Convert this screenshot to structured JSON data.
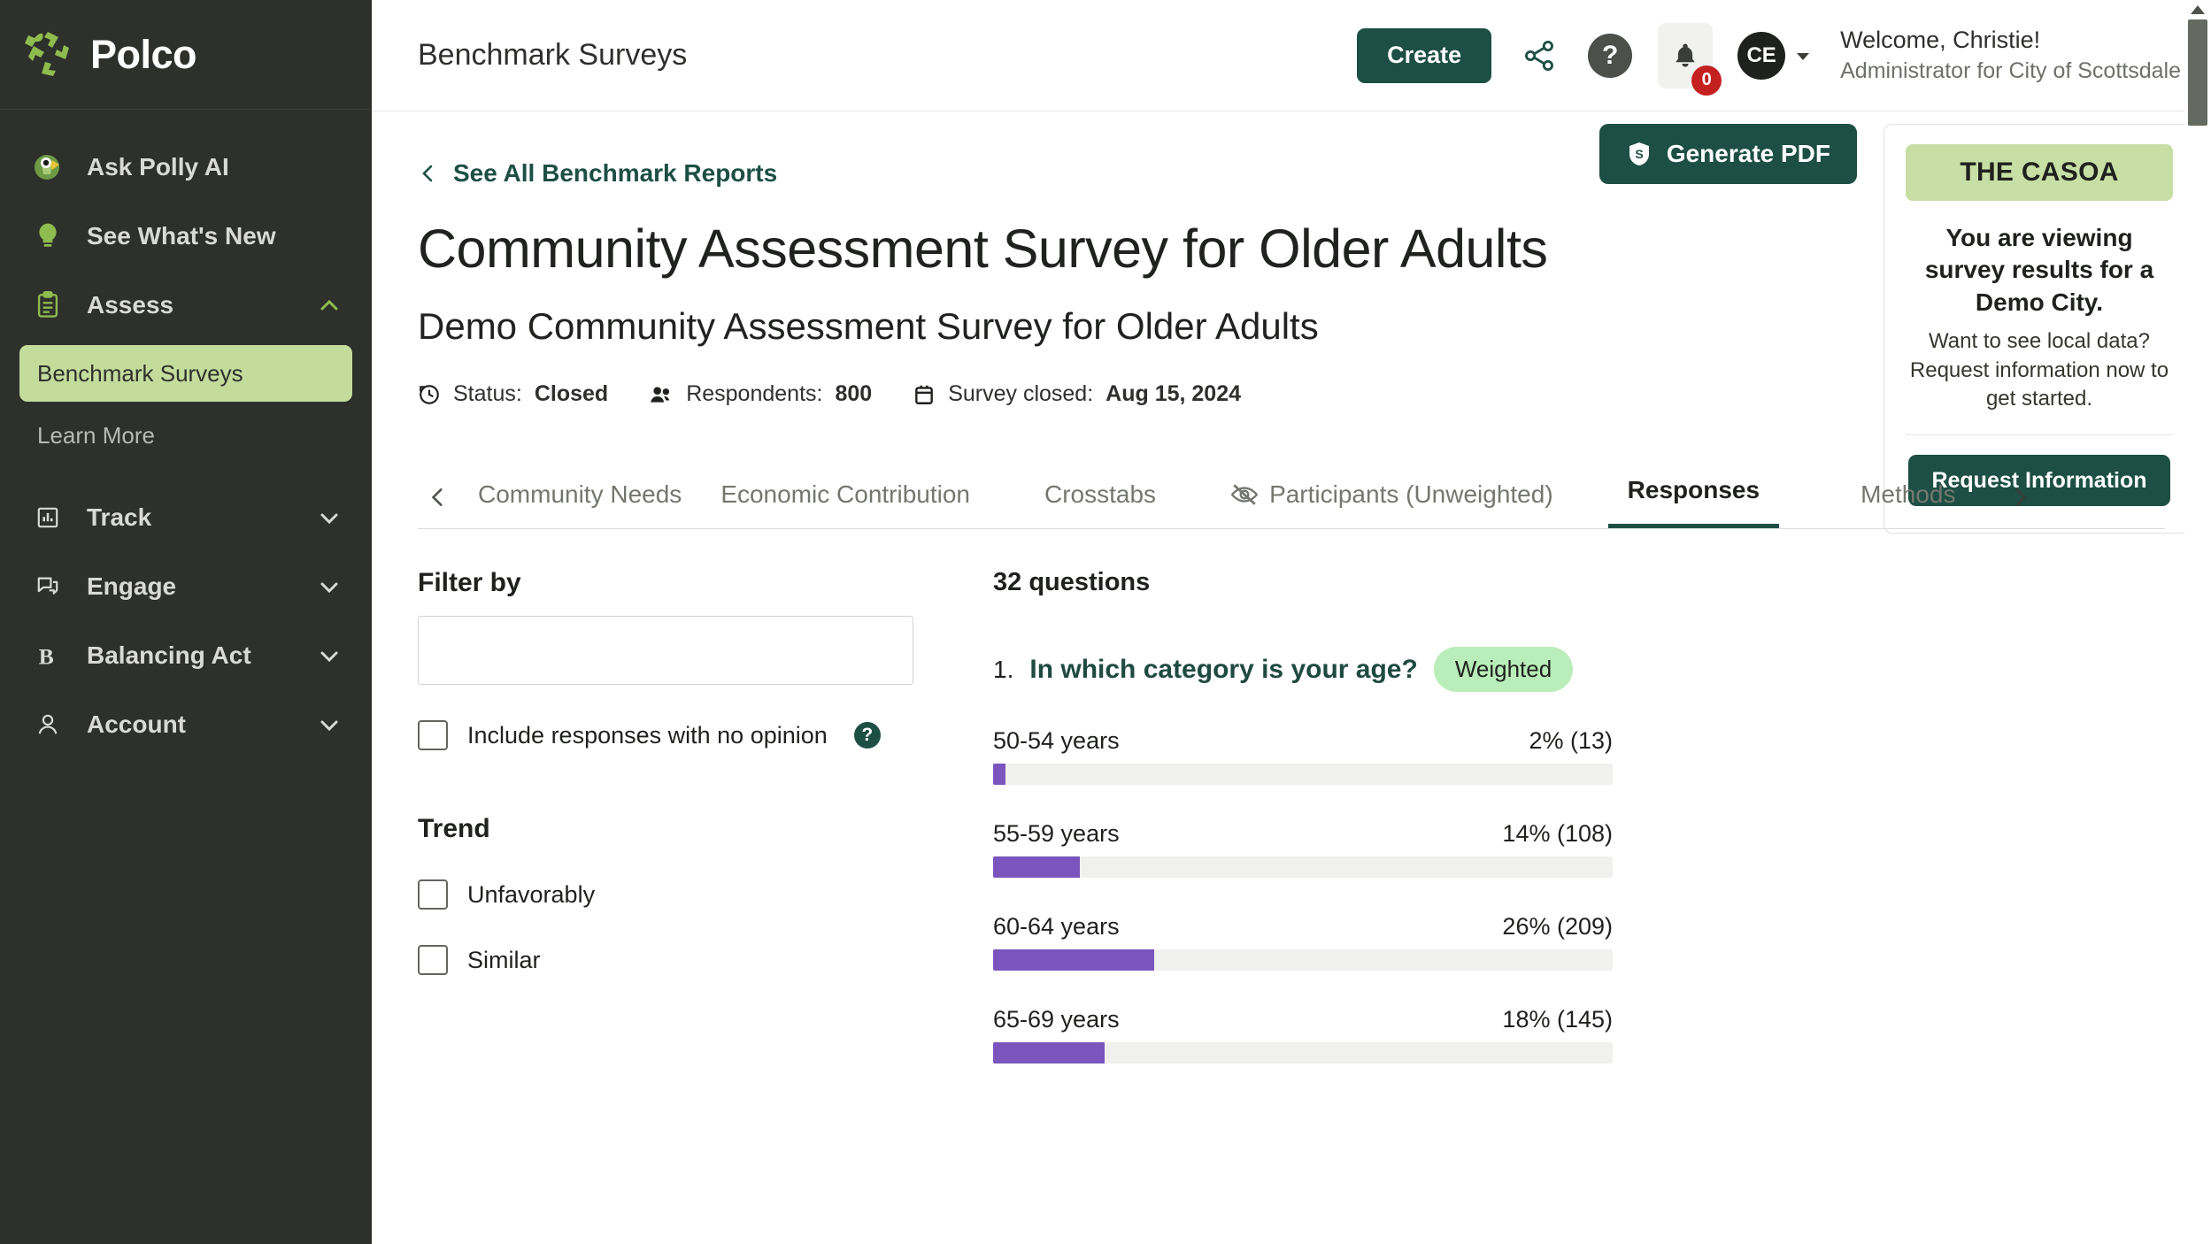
{
  "brand": {
    "name": "Polco",
    "logo_icon": "polco-pinwheel-logo",
    "accent_green": "#8fbc4e",
    "dark_green": "#1d4f44",
    "sidebar_bg": "#2e302c"
  },
  "sidebar": {
    "items": [
      {
        "label": "Ask Polly AI",
        "icon": "parrot-icon",
        "expandable": false
      },
      {
        "label": "See What's New",
        "icon": "lightbulb-icon",
        "expandable": false
      },
      {
        "label": "Assess",
        "icon": "clipboard-icon",
        "expandable": true,
        "expanded": true,
        "children": [
          {
            "label": "Benchmark Surveys",
            "active": true
          },
          {
            "label": "Learn More",
            "active": false
          }
        ]
      },
      {
        "label": "Track",
        "icon": "bar-chart-icon",
        "expandable": true,
        "expanded": false
      },
      {
        "label": "Engage",
        "icon": "chat-bubbles-icon",
        "expandable": true,
        "expanded": false
      },
      {
        "label": "Balancing Act",
        "icon": "letter-b-icon",
        "expandable": true,
        "expanded": false
      },
      {
        "label": "Account",
        "icon": "person-icon",
        "expandable": true,
        "expanded": false
      }
    ]
  },
  "topbar": {
    "title": "Benchmark Surveys",
    "create_label": "Create",
    "share_icon": "share-icon",
    "help_icon": "question-mark-icon",
    "bell_icon": "bell-icon",
    "notification_count": "0",
    "avatar_initials": "CE",
    "welcome_line1": "Welcome, Christie!",
    "welcome_line2": "Administrator for City of Scottsdale"
  },
  "content": {
    "back_link": "See All Benchmark Reports",
    "title": "Community Assessment Survey for Older Adults",
    "subtitle": "Demo Community Assessment Survey for Older Adults",
    "meta": [
      {
        "icon": "clock-history-icon",
        "label": "Status:",
        "value": "Closed"
      },
      {
        "icon": "people-icon",
        "label": "Respondents:",
        "value": "800"
      },
      {
        "icon": "calendar-icon",
        "label": "Survey closed:",
        "value": "Aug 15, 2024"
      }
    ],
    "generate_pdf_label": "Generate PDF",
    "generate_pdf_icon": "shield-s-icon"
  },
  "casoa": {
    "banner": "THE CASOA",
    "heading": "You are viewing survey results for a Demo City.",
    "paragraph": "Want to see local data? Request information now to get started.",
    "button_label": "Request Information",
    "banner_color": "#c7dfa4"
  },
  "tabs": {
    "prev_icon": "chevron-left-icon",
    "next_icon": "chevron-right-icon",
    "items": [
      {
        "label": "Community Needs",
        "active": false,
        "icon": null
      },
      {
        "label": "Economic Contribution",
        "active": false,
        "icon": null
      },
      {
        "label": "Crosstabs",
        "active": false,
        "icon": null
      },
      {
        "label": "Participants (Unweighted)",
        "active": false,
        "icon": "eye-slash-icon"
      },
      {
        "label": "Responses",
        "active": true,
        "icon": null
      },
      {
        "label": "Methods",
        "active": false,
        "icon": null
      }
    ]
  },
  "filters": {
    "filter_by_label": "Filter by",
    "filter_input_value": "",
    "filter_input_placeholder": "",
    "include_no_opinion_label": "Include responses with no opinion",
    "include_no_opinion_checked": false,
    "help_icon": "question-circle-icon",
    "trend_label": "Trend",
    "trend_options": [
      {
        "label": "Unfavorably",
        "checked": false
      },
      {
        "label": "Similar",
        "checked": false
      }
    ]
  },
  "results": {
    "question_count": "32 questions",
    "question_number": "1.",
    "question_text": "In which category is your age?",
    "badge": "Weighted"
  },
  "chart_data": {
    "type": "bar",
    "title": "In which category is your age?",
    "orientation": "horizontal",
    "xlabel": "",
    "ylabel": "",
    "xlim": [
      0,
      100
    ],
    "unit": "percent",
    "grid": false,
    "legend": "none",
    "bar_color": "#7b55bd",
    "track_color": "#f0f0ef",
    "categories": [
      "50-54 years",
      "55-59 years",
      "60-64 years",
      "65-69 years"
    ],
    "values": [
      2,
      14,
      26,
      18
    ],
    "counts": [
      13,
      108,
      209,
      145
    ],
    "labels": [
      "2% (13)",
      "14% (108)",
      "26% (209)",
      "18% (145)"
    ]
  }
}
